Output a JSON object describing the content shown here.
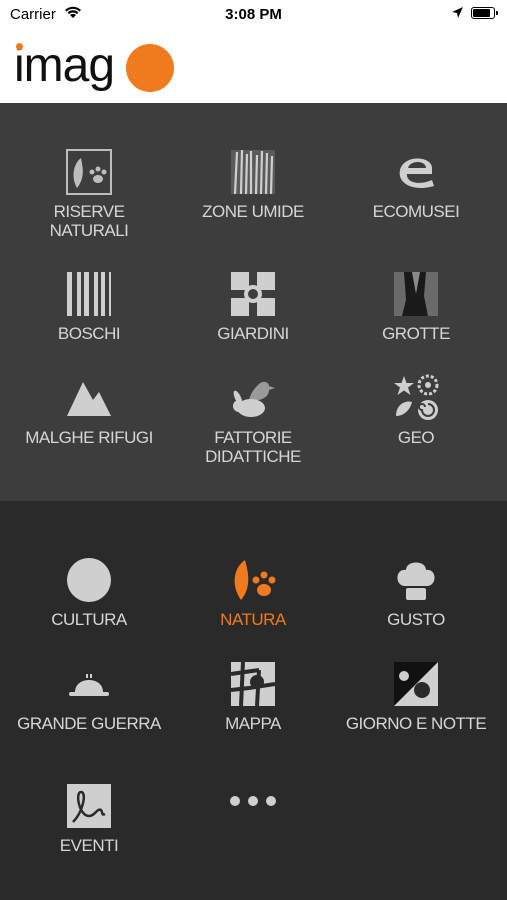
{
  "status_bar": {
    "carrier": "Carrier",
    "time": "3:08 PM",
    "battery_level": 0.9
  },
  "header": {
    "logo_text": "imag",
    "accent_color": "#f07a1e"
  },
  "categories": [
    {
      "label": "RISERVE NATURALI",
      "icon": "paw-leaf-icon"
    },
    {
      "label": "ZONE UMIDE",
      "icon": "reeds-icon"
    },
    {
      "label": "ECOMUSEI",
      "icon": "ecomuseo-e-icon"
    },
    {
      "label": "BOSCHI",
      "icon": "tree-trunks-icon"
    },
    {
      "label": "GIARDINI",
      "icon": "garden-icon"
    },
    {
      "label": "GROTTE",
      "icon": "cave-icon"
    },
    {
      "label": "MALGHE RIFUGI",
      "icon": "mountain-icon"
    },
    {
      "label": "FATTORIE DIDATTICHE",
      "icon": "duck-rabbit-icon"
    },
    {
      "label": "GEO",
      "icon": "fossil-icon"
    }
  ],
  "sections": [
    {
      "label": "CULTURA",
      "icon": "circle-icon",
      "active": false
    },
    {
      "label": "NATURA",
      "icon": "paw-leaf-icon",
      "active": true
    },
    {
      "label": "GUSTO",
      "icon": "chef-hat-icon",
      "active": false
    },
    {
      "label": "GRANDE GUERRA",
      "icon": "helmet-icon",
      "active": false
    },
    {
      "label": "MAPPA",
      "icon": "map-icon",
      "active": false
    },
    {
      "label": "GIORNO E NOTTE",
      "icon": "day-night-icon",
      "active": false
    },
    {
      "label": "EVENTI",
      "icon": "signature-icon",
      "active": false
    }
  ],
  "more": {
    "icon": "more-dots-icon"
  }
}
